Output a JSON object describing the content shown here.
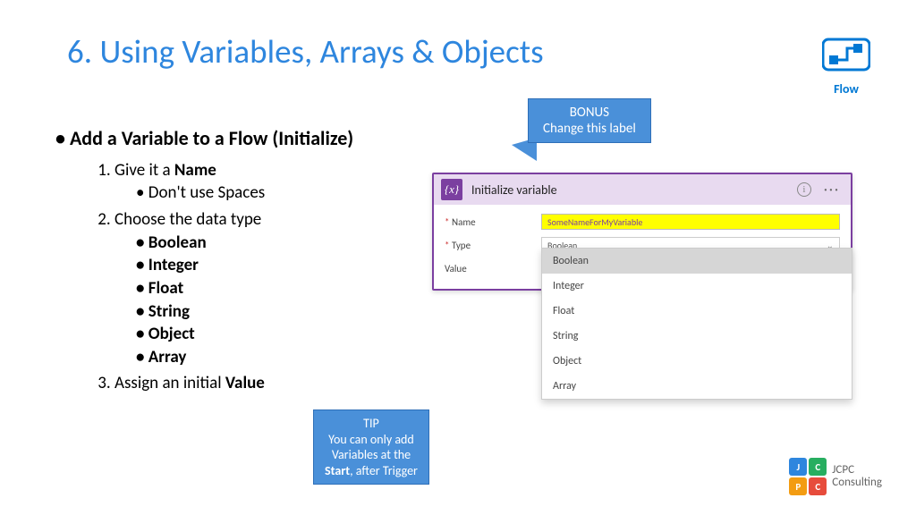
{
  "slide": {
    "title": "6. Using Variables, Arrays & Objects"
  },
  "flow_logo": {
    "label": "Flow"
  },
  "bonus": {
    "line1": "BONUS",
    "line2": "Change this label"
  },
  "tip": {
    "line1": "TIP",
    "line2": "You can only add",
    "line3": "Variables at the",
    "line4_bold": "Start",
    "line4_rest": ", after Trigger"
  },
  "content": {
    "heading": "Add a Variable to a Flow (Initialize)",
    "steps": [
      {
        "pre": "Give it a ",
        "bold": "Name",
        "sub": [
          {
            "text": "Don't use Spaces",
            "bold": false
          }
        ]
      },
      {
        "pre": "Choose the data type",
        "bold": "",
        "sub": [
          {
            "text": "Boolean",
            "bold": true
          },
          {
            "text": "Integer",
            "bold": true
          },
          {
            "text": "Float",
            "bold": true
          },
          {
            "text": "String",
            "bold": true
          },
          {
            "text": "Object",
            "bold": true
          },
          {
            "text": "Array",
            "bold": true
          }
        ]
      },
      {
        "pre": "Assign an initial ",
        "bold": "Value",
        "sub": []
      }
    ]
  },
  "card": {
    "icon_text": "{x}",
    "title": "Initialize variable",
    "rows": {
      "name": {
        "label": "Name",
        "required": true,
        "value": "SomeNameForMyVariable"
      },
      "type": {
        "label": "Type",
        "required": true,
        "value": "Boolean"
      },
      "value": {
        "label": "Value",
        "required": false,
        "value": ""
      }
    }
  },
  "dropdown": {
    "selected_index": 0,
    "options": [
      "Boolean",
      "Integer",
      "Float",
      "String",
      "Object",
      "Array"
    ]
  },
  "jcpc": {
    "letters": [
      "J",
      "C",
      "P",
      "C"
    ],
    "line1": "JCPC",
    "line2": "Consulting"
  }
}
